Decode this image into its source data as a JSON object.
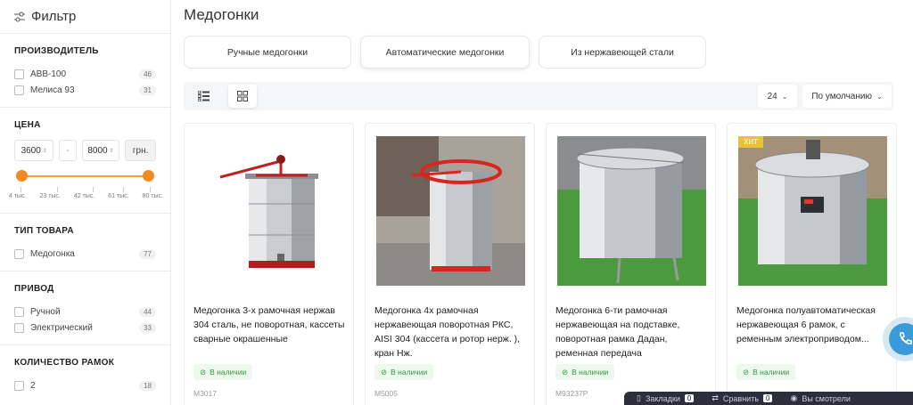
{
  "sidebar": {
    "filter_title": "Фильтр",
    "manufacturer": {
      "title": "ПРОИЗВОДИТЕЛЬ",
      "options": [
        {
          "label": "ABB-100",
          "count": "46"
        },
        {
          "label": "Мелиса 93",
          "count": "31"
        }
      ]
    },
    "price": {
      "title": "ЦЕНА",
      "from": "3600",
      "separator": "-",
      "to": "8000",
      "currency": "грн.",
      "ticks": [
        "4 тыс.",
        "23 тыс.",
        "42 тыс.",
        "61 тыс.",
        "80 тыс."
      ]
    },
    "type": {
      "title": "ТИП ТОВАРА",
      "options": [
        {
          "label": "Медогонка",
          "count": "77"
        }
      ]
    },
    "drive": {
      "title": "ПРИВОД",
      "options": [
        {
          "label": "Ручной",
          "count": "44"
        },
        {
          "label": "Электрический",
          "count": "33"
        }
      ]
    },
    "frames": {
      "title": "КОЛИЧЕСТВО РАМОК",
      "options": [
        {
          "label": "2",
          "count": "18"
        }
      ]
    }
  },
  "main": {
    "title": "Медогонки",
    "tabs": [
      "Ручные медогонки",
      "Автоматические медогонки",
      "Из нержавеющей стали"
    ],
    "per_page": "24",
    "sort": "По умолчанию",
    "products": [
      {
        "name": "Медогонка 3-х рамочная нержав 304 сталь, не поворотная, кассеты сварные окрашенные",
        "stock": "В наличии",
        "sku": "M3017"
      },
      {
        "name": "Медогонка 4х рамочная нержавеющая поворотная РКС, AISI 304 (кассета и ротор нерж. ), кран Нж.",
        "stock": "В наличии",
        "sku": "M5005"
      },
      {
        "name": "Медогонка 6-ти рамочная нержавеющая на подставке, поворотная рамка Дадан, ременная передача",
        "stock": "В наличии",
        "sku": "M93237P"
      },
      {
        "name": "Медогонка полуавтоматическая нержавеющая 6 рамок, с ременным электроприводом...",
        "stock": "В наличии",
        "sku": "",
        "badge": "ХИТ"
      }
    ]
  },
  "bottombar": {
    "items": [
      {
        "label": "Закладки",
        "count": "0"
      },
      {
        "label": "Сравнить",
        "count": "0"
      },
      {
        "label": "Вы смотрели"
      }
    ]
  },
  "colors": {
    "accent": "#ef8a1f",
    "stock_green": "#2e9b3a",
    "hit_yellow": "#e9c23a",
    "chat_blue": "#3b9bd9"
  }
}
